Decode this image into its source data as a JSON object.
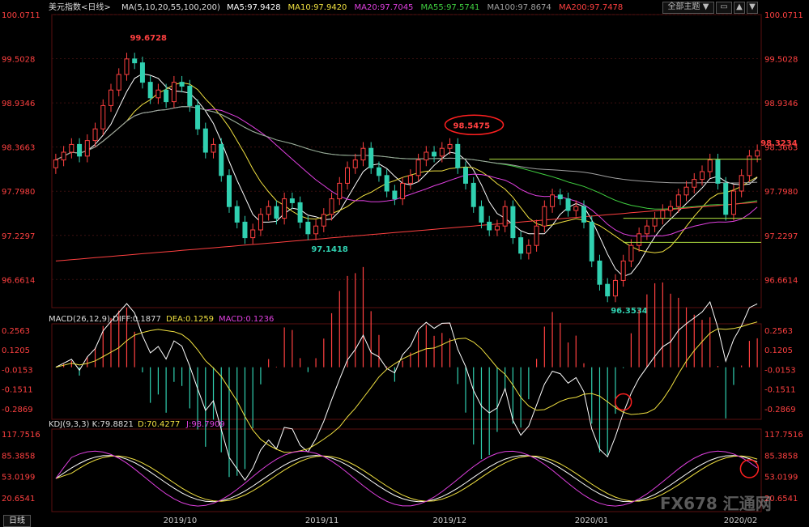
{
  "header": {
    "instrument": "美元指数",
    "period": "<日线>",
    "ma_params": "MA(5,10,20,55,100,200)",
    "ma_values": [
      {
        "label": "MA5:97.9428",
        "color": "#ffffff"
      },
      {
        "label": "MA10:97.9420",
        "color": "#f0e040"
      },
      {
        "label": "MA20:97.7045",
        "color": "#e040e0"
      },
      {
        "label": "MA55:97.5741",
        "color": "#40d040"
      },
      {
        "label": "MA100:97.8674",
        "color": "#a0a0a0"
      },
      {
        "label": "MA200:97.7478",
        "color": "#ff4040"
      }
    ],
    "theme_button": "全部主题",
    "theme_button_icon": "dropdown-arrow-icon"
  },
  "macd_header": {
    "params": "MACD(26,12,9)",
    "diff": "DIFF:0.1877",
    "dea": "DEA:0.1259",
    "macd": "MACD:0.1236"
  },
  "kdj_header": {
    "params": "KDJ(9,3,3)",
    "k": "K:79.8821",
    "d": "D:70.4277",
    "j": "J:98.7909"
  },
  "bottom_tab": "日线",
  "watermark": "FX678 汇通网",
  "colors": {
    "up": "#ff4040",
    "down": "#30d0b0",
    "ma5": "#ffffff",
    "ma10": "#f0e040",
    "ma20": "#e040e0",
    "ma55": "#40d040",
    "ma100": "#a0a0a0",
    "ma200": "#ff4040",
    "axis_text_price": "#ff4040",
    "grid": "#3a1010",
    "annotation_circle": "#ff2020"
  },
  "chart_data": [
    {
      "type": "candlestick",
      "title": "美元指数 日线",
      "y_tick_labels": [
        "100.0711",
        "99.5028",
        "98.9346",
        "98.3663",
        "97.7980",
        "97.2297",
        "96.6614"
      ],
      "ylim": [
        96.3,
        100.0711
      ],
      "x_labels": [
        "2019/10",
        "2019/11",
        "2019/12",
        "2020/01",
        "2020/02"
      ],
      "annotations": [
        {
          "text": "99.6728",
          "value": 99.6728,
          "label_color": "#ff4040"
        },
        {
          "text": "97.1418",
          "value": 97.1418,
          "label_color": "#30d0b0"
        },
        {
          "text": "98.5475",
          "value": 98.5475,
          "label_color": "#ff4040",
          "circled": true
        },
        {
          "text": "96.3534",
          "value": 96.3534,
          "label_color": "#30d0b0"
        },
        {
          "text": "98.3234",
          "value": 98.3234,
          "label_color": "#ff4040"
        }
      ],
      "horizontal_levels": [
        98.21,
        97.45,
        97.14
      ],
      "close_path": [
        98.2,
        98.3,
        98.4,
        98.25,
        98.45,
        98.6,
        98.9,
        99.1,
        99.3,
        99.5,
        99.45,
        99.2,
        99.0,
        99.1,
        98.95,
        99.2,
        99.15,
        98.9,
        98.6,
        98.3,
        98.4,
        98.0,
        97.6,
        97.4,
        97.2,
        97.3,
        97.5,
        97.6,
        97.45,
        97.7,
        97.65,
        97.4,
        97.25,
        97.35,
        97.5,
        97.7,
        97.9,
        98.1,
        98.2,
        98.35,
        98.1,
        98.0,
        97.8,
        97.7,
        97.9,
        98.0,
        98.2,
        98.3,
        98.25,
        98.35,
        98.4,
        98.1,
        97.9,
        97.6,
        97.4,
        97.3,
        97.35,
        97.6,
        97.2,
        97.0,
        97.1,
        97.35,
        97.6,
        97.75,
        97.7,
        97.55,
        97.6,
        97.4,
        96.9,
        96.6,
        96.45,
        96.65,
        96.9,
        97.1,
        97.25,
        97.35,
        97.45,
        97.55,
        97.6,
        97.75,
        97.85,
        97.95,
        98.05,
        98.2,
        97.9,
        97.5,
        97.8,
        98.0,
        98.25,
        98.32
      ]
    },
    {
      "type": "macd",
      "title": "MACD(26,12,9)",
      "y_tick_labels": [
        "0.2563",
        "0.1205",
        "-0.0153",
        "-0.1511",
        "-0.2869"
      ],
      "ylim": [
        -0.36,
        0.3
      ],
      "series_values": {
        "DIFF": 0.1877,
        "DEA": 0.1259,
        "MACD": 0.1236
      }
    },
    {
      "type": "kdj",
      "title": "KDJ(9,3,3)",
      "y_tick_labels": [
        "117.7516",
        "85.3858",
        "53.0199",
        "20.6541"
      ],
      "ylim": [
        0,
        125
      ],
      "series_values": {
        "K": 79.8821,
        "D": 70.4277,
        "J": 98.7909
      }
    }
  ]
}
